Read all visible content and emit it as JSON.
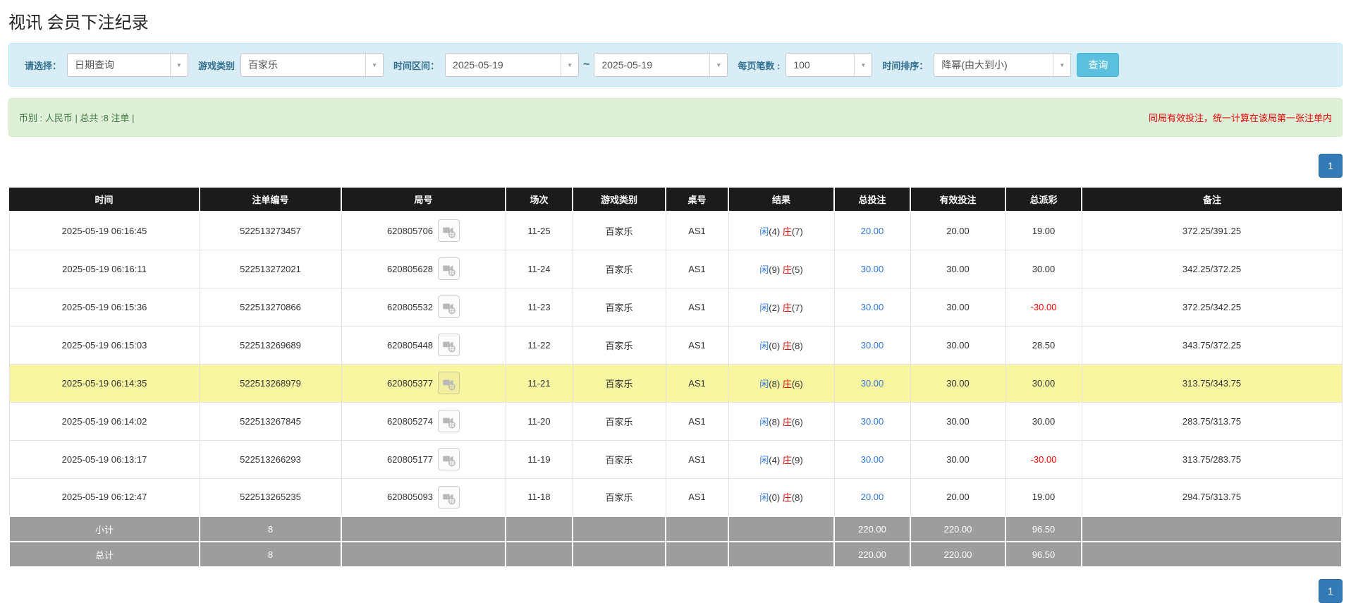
{
  "page": {
    "title": "视讯 会员下注纪录"
  },
  "filters": {
    "select_label": "请选择：",
    "select_value": "日期查询",
    "game_type_label": "游戏类别",
    "game_type_value": "百家乐",
    "date_range_label": "时间区间：",
    "date_from": "2025-05-19",
    "date_tilde": "~",
    "date_to": "2025-05-19",
    "page_size_label": "每页笔数 :",
    "page_size_value": "100",
    "sort_label": "时间排序：",
    "sort_value": "降幂(由大到小)",
    "search_button": "查询",
    "dropdown_arrow": "▼"
  },
  "summary": {
    "left": "币别 : 人民币 | 总共 :8 注单 |",
    "right": "同局有效投注，统一计算在该局第一张注单内"
  },
  "pagination": {
    "page": "1"
  },
  "table": {
    "headers": [
      "时间",
      "注单编号",
      "局号",
      "场次",
      "游戏类别",
      "桌号",
      "结果",
      "总投注",
      "有效投注",
      "总派彩",
      "备注"
    ],
    "rows": [
      {
        "time": "2025-05-19 06:16:45",
        "bet_id": "522513273457",
        "round_id": "620805706",
        "session": "11-25",
        "game": "百家乐",
        "table_no": "AS1",
        "player_name": "闲",
        "player_pts": "(4)",
        "banker_name": "庄",
        "banker_pts": "(7)",
        "total_bet": "20.00",
        "valid_bet": "20.00",
        "payout": "19.00",
        "remark": "372.25/391.25",
        "highlight": false
      },
      {
        "time": "2025-05-19 06:16:11",
        "bet_id": "522513272021",
        "round_id": "620805628",
        "session": "11-24",
        "game": "百家乐",
        "table_no": "AS1",
        "player_name": "闲",
        "player_pts": "(9)",
        "banker_name": "庄",
        "banker_pts": "(5)",
        "total_bet": "30.00",
        "valid_bet": "30.00",
        "payout": "30.00",
        "remark": "342.25/372.25",
        "highlight": false
      },
      {
        "time": "2025-05-19 06:15:36",
        "bet_id": "522513270866",
        "round_id": "620805532",
        "session": "11-23",
        "game": "百家乐",
        "table_no": "AS1",
        "player_name": "闲",
        "player_pts": "(2)",
        "banker_name": "庄",
        "banker_pts": "(7)",
        "total_bet": "30.00",
        "valid_bet": "30.00",
        "payout": "-30.00",
        "remark": "372.25/342.25",
        "highlight": false
      },
      {
        "time": "2025-05-19 06:15:03",
        "bet_id": "522513269689",
        "round_id": "620805448",
        "session": "11-22",
        "game": "百家乐",
        "table_no": "AS1",
        "player_name": "闲",
        "player_pts": "(0)",
        "banker_name": "庄",
        "banker_pts": "(8)",
        "total_bet": "30.00",
        "valid_bet": "30.00",
        "payout": "28.50",
        "remark": "343.75/372.25",
        "highlight": false
      },
      {
        "time": "2025-05-19 06:14:35",
        "bet_id": "522513268979",
        "round_id": "620805377",
        "session": "11-21",
        "game": "百家乐",
        "table_no": "AS1",
        "player_name": "闲",
        "player_pts": "(8)",
        "banker_name": "庄",
        "banker_pts": "(6)",
        "total_bet": "30.00",
        "valid_bet": "30.00",
        "payout": "30.00",
        "remark": "313.75/343.75",
        "highlight": true
      },
      {
        "time": "2025-05-19 06:14:02",
        "bet_id": "522513267845",
        "round_id": "620805274",
        "session": "11-20",
        "game": "百家乐",
        "table_no": "AS1",
        "player_name": "闲",
        "player_pts": "(8)",
        "banker_name": "庄",
        "banker_pts": "(6)",
        "total_bet": "30.00",
        "valid_bet": "30.00",
        "payout": "30.00",
        "remark": "283.75/313.75",
        "highlight": false
      },
      {
        "time": "2025-05-19 06:13:17",
        "bet_id": "522513266293",
        "round_id": "620805177",
        "session": "11-19",
        "game": "百家乐",
        "table_no": "AS1",
        "player_name": "闲",
        "player_pts": "(4)",
        "banker_name": "庄",
        "banker_pts": "(9)",
        "total_bet": "30.00",
        "valid_bet": "30.00",
        "payout": "-30.00",
        "remark": "313.75/283.75",
        "highlight": false
      },
      {
        "time": "2025-05-19 06:12:47",
        "bet_id": "522513265235",
        "round_id": "620805093",
        "session": "11-18",
        "game": "百家乐",
        "table_no": "AS1",
        "player_name": "闲",
        "player_pts": "(0)",
        "banker_name": "庄",
        "banker_pts": "(8)",
        "total_bet": "20.00",
        "valid_bet": "20.00",
        "payout": "19.00",
        "remark": "294.75/313.75",
        "highlight": false
      }
    ],
    "footer": [
      {
        "label": "小计",
        "count": "8",
        "total_bet": "220.00",
        "valid_bet": "220.00",
        "payout": "96.50"
      },
      {
        "label": "总计",
        "count": "8",
        "total_bet": "220.00",
        "valid_bet": "220.00",
        "payout": "96.50"
      }
    ]
  }
}
